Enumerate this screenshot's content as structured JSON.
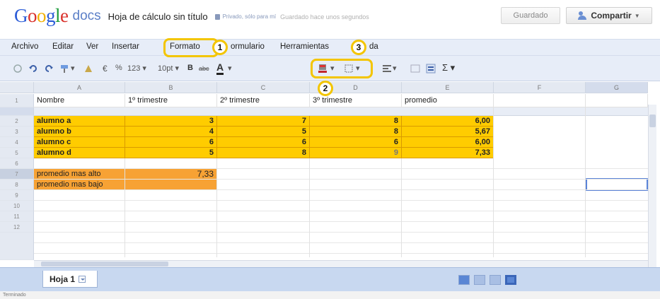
{
  "header": {
    "logo_parts": [
      "G",
      "o",
      "o",
      "g",
      "l",
      "e"
    ],
    "docs": "docs",
    "title": "Hoja de cálculo sin título",
    "privacy": "Privado, sólo para mí",
    "saved_status": "Guardado hace unos segundos",
    "saved_button": "Guardado",
    "share_button": "Compartir"
  },
  "menu": {
    "items": [
      "Archivo",
      "Editar",
      "Ver",
      "Insertar",
      "Formato",
      "ormulario",
      "Herramientas",
      "da"
    ]
  },
  "toolbar": {
    "currency": "€",
    "percent": "%",
    "format": "123 ▾",
    "font_size": "10pt ▾",
    "bold": "B",
    "strike": "abc",
    "text_color": "A",
    "sum": "Σ ▾"
  },
  "grid": {
    "columns": [
      "A",
      "B",
      "C",
      "D",
      "E",
      "F",
      "G"
    ],
    "row_numbers": [
      "1",
      "2",
      "3",
      "4",
      "5",
      "6",
      "7",
      "8",
      "9",
      "10",
      "11",
      "12"
    ],
    "header_row": [
      "Nombre",
      "1º trimestre",
      "2º trimestre",
      "3º trimestre",
      "promedio"
    ],
    "data_rows": [
      {
        "name": "alumno a",
        "t1": "3",
        "t2": "7",
        "t3": "8",
        "avg": "6,00"
      },
      {
        "name": "alumno b",
        "t1": "4",
        "t2": "5",
        "t3": "8",
        "avg": "5,67"
      },
      {
        "name": "alumno c",
        "t1": "6",
        "t2": "6",
        "t3": "6",
        "avg": "6,00"
      },
      {
        "name": "alumno d",
        "t1": "5",
        "t2": "8",
        "t3": "9",
        "avg": "7,33"
      }
    ],
    "max_label": "promedio mas alto",
    "max_value": "7,33",
    "min_label": "promedio mas bajo"
  },
  "sheets": {
    "tab": "Hoja 1"
  },
  "status": "Terminado",
  "callouts": [
    "1",
    "2",
    "3"
  ],
  "colors": {
    "yellow": "#ffcc00",
    "orange": "#f7a234",
    "callout": "#f3c500"
  }
}
